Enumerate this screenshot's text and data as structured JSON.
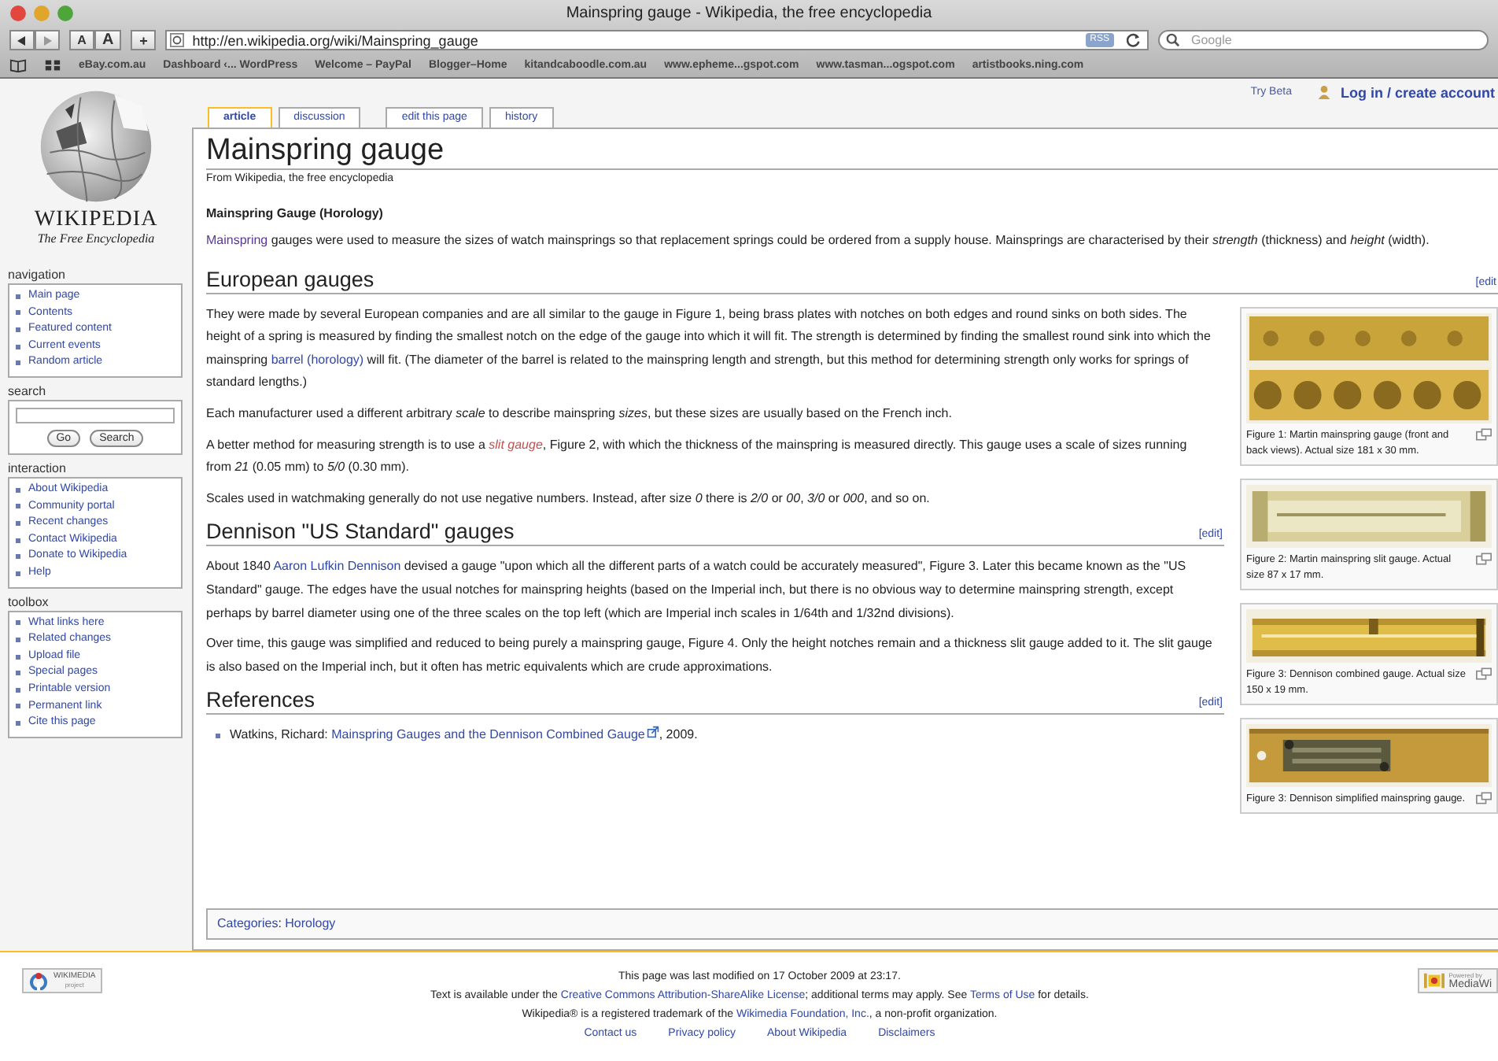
{
  "browser": {
    "title": "Mainspring gauge - Wikipedia, the free encyclopedia",
    "text_size_buttons": [
      "A",
      "A"
    ],
    "add_button": "+",
    "url": "http://en.wikipedia.org/wiki/Mainspring_gauge",
    "rss_badge": "RSS",
    "search_placeholder": "Google",
    "bookmarks": [
      "eBay.com.au",
      "Dashboard ‹... WordPress",
      "Welcome – PayPal",
      "Blogger–Home",
      "kitandcaboodle.com.au",
      "www.epheme...gspot.com",
      "www.tasman...ogspot.com",
      "artistbooks.ning.com"
    ]
  },
  "personal": {
    "try_beta": "Try Beta",
    "login": "Log in / create account"
  },
  "tabs": [
    {
      "label": "article",
      "selected": true
    },
    {
      "label": "discussion",
      "selected": false
    },
    {
      "label": "edit this page",
      "selected": false
    },
    {
      "label": "history",
      "selected": false
    }
  ],
  "logo": {
    "wordmark": "WIKIPEDIA",
    "tagline": "The Free Encyclopedia"
  },
  "sidebar": [
    {
      "heading": "navigation",
      "kind": "links",
      "items": [
        "Main page",
        "Contents",
        "Featured content",
        "Current events",
        "Random article"
      ]
    },
    {
      "heading": "search",
      "kind": "search",
      "buttons": [
        "Go",
        "Search"
      ]
    },
    {
      "heading": "interaction",
      "kind": "links",
      "items": [
        "About Wikipedia",
        "Community portal",
        "Recent changes",
        "Contact Wikipedia",
        "Donate to Wikipedia",
        "Help"
      ]
    },
    {
      "heading": "toolbox",
      "kind": "links",
      "items": [
        "What links here",
        "Related changes",
        "Upload file",
        "Special pages",
        "Printable version",
        "Permanent link",
        "Cite this page"
      ]
    }
  ],
  "article": {
    "title": "Mainspring gauge",
    "tagline": "From Wikipedia, the free encyclopedia",
    "dablink": "Mainspring Gauge (Horology)",
    "intro": [
      {
        "kind": "visited_link",
        "text": "Mainspring"
      },
      {
        "kind": "text",
        "text": " gauges were used to measure the sizes of watch mainsprings so that replacement springs could be ordered from a supply house. Mainsprings are characterised by their *strength* (thickness) and *height* (width)."
      }
    ],
    "sections": [
      {
        "heading": "European gauges",
        "edit": "[edit",
        "paragraphs": [
          [
            {
              "kind": "text",
              "text": "They were made by several European companies and are all similar to the gauge in Figure 1, being brass plates with notches on both edges and round sinks on both sides. The height of a spring is measured by finding the smallest notch on the edge of the gauge into which it will fit. The strength is determined by finding the smallest round sink into which the mainspring "
            },
            {
              "kind": "link",
              "text": "barrel (horology)"
            },
            {
              "kind": "text",
              "text": " will fit. (The diameter of the barrel is related to the mainspring length and strength, but this method for determining strength only works for springs of standard lengths.)"
            }
          ],
          [
            {
              "kind": "text",
              "text": "Each manufacturer used a different arbitrary *scale* to describe mainspring *sizes*, but these sizes are usually based on the French inch."
            }
          ],
          [
            {
              "kind": "text",
              "text": "A better method for measuring strength is to use a "
            },
            {
              "kind": "new_link",
              "text": "slit gauge"
            },
            {
              "kind": "text",
              "text": ", Figure 2, with which the thickness of the mainspring is measured directly. This gauge uses a scale of sizes running from *21* (0.05 mm) to *5/0* (0.30 mm)."
            }
          ],
          [
            {
              "kind": "text",
              "text": "Scales used in watchmaking generally do not use negative numbers. Instead, after size *0* there is *2/0* or *00*, *3/0* or *000*, and so on."
            }
          ]
        ]
      },
      {
        "heading": "Dennison \"US Standard\" gauges",
        "edit": "[edit]",
        "paragraphs": [
          [
            {
              "kind": "text",
              "text": "About 1840 "
            },
            {
              "kind": "link",
              "text": "Aaron Lufkin Dennison"
            },
            {
              "kind": "text",
              "text": " devised a gauge \"upon which all the different parts of a watch could be accurately measured\", Figure 3. Later this became known as the \"US Standard\" gauge. The edges have the usual notches for mainspring heights (based on the Imperial inch, but there is no obvious way to determine mainspring strength, except perhaps by barrel diameter using one of the three scales on the top left (which are Imperial inch scales in 1/64th and 1/32nd divisions)."
            }
          ],
          [
            {
              "kind": "text",
              "text": "Over time, this gauge was simplified and reduced to being purely a mainspring gauge, Figure 4. Only the height notches remain and a thickness slit gauge added to it. The slit gauge is also based on the Imperial inch, but it often has metric equivalents which are crude approximations."
            }
          ]
        ]
      },
      {
        "heading": "References",
        "edit": "[edit]",
        "list": [
          [
            {
              "kind": "text",
              "text": "Watkins, Richard: "
            },
            {
              "kind": "external_link",
              "text": "Mainspring Gauges and the Dennison Combined Gauge"
            },
            {
              "kind": "text",
              "text": ", 2009."
            }
          ]
        ]
      }
    ],
    "figures": [
      {
        "caption": "Figure 1: Martin mainspring gauge (front and back views). Actual size 181 x 30 mm."
      },
      {
        "caption": "Figure 2: Martin mainspring slit gauge. Actual size 87 x 17 mm."
      },
      {
        "caption": "Figure 3: Dennison combined gauge. Actual size 150 x 19 mm."
      },
      {
        "caption": "Figure 3: Dennison simplified mainspring gauge."
      }
    ],
    "categories": [
      {
        "kind": "link",
        "text": "Categories"
      },
      {
        "kind": "text",
        "text": ": "
      },
      {
        "kind": "link",
        "text": "Horology"
      }
    ]
  },
  "footer": {
    "wikimedia_badge": "WIKIMEDIA",
    "wikimedia_sub": "project",
    "mediawiki_top": "Powered by",
    "mediawiki_name": "MediaWi",
    "lines": [
      [
        {
          "kind": "text",
          "text": "This page was last modified on 17 October 2009 at 23:17."
        }
      ],
      [
        {
          "kind": "text",
          "text": "Text is available under the "
        },
        {
          "kind": "link",
          "text": "Creative Commons Attribution-ShareAlike License"
        },
        {
          "kind": "text",
          "text": "; additional terms may apply. See "
        },
        {
          "kind": "link",
          "text": "Terms of Use"
        },
        {
          "kind": "text",
          "text": " for details."
        }
      ],
      [
        {
          "kind": "text",
          "text": "Wikipedia® is a registered trademark of the "
        },
        {
          "kind": "link",
          "text": "Wikimedia Foundation, Inc."
        },
        {
          "kind": "text",
          "text": ", a non-profit organization."
        }
      ]
    ],
    "links": [
      "Contact us",
      "Privacy policy",
      "About Wikipedia",
      "Disclaimers"
    ]
  }
}
